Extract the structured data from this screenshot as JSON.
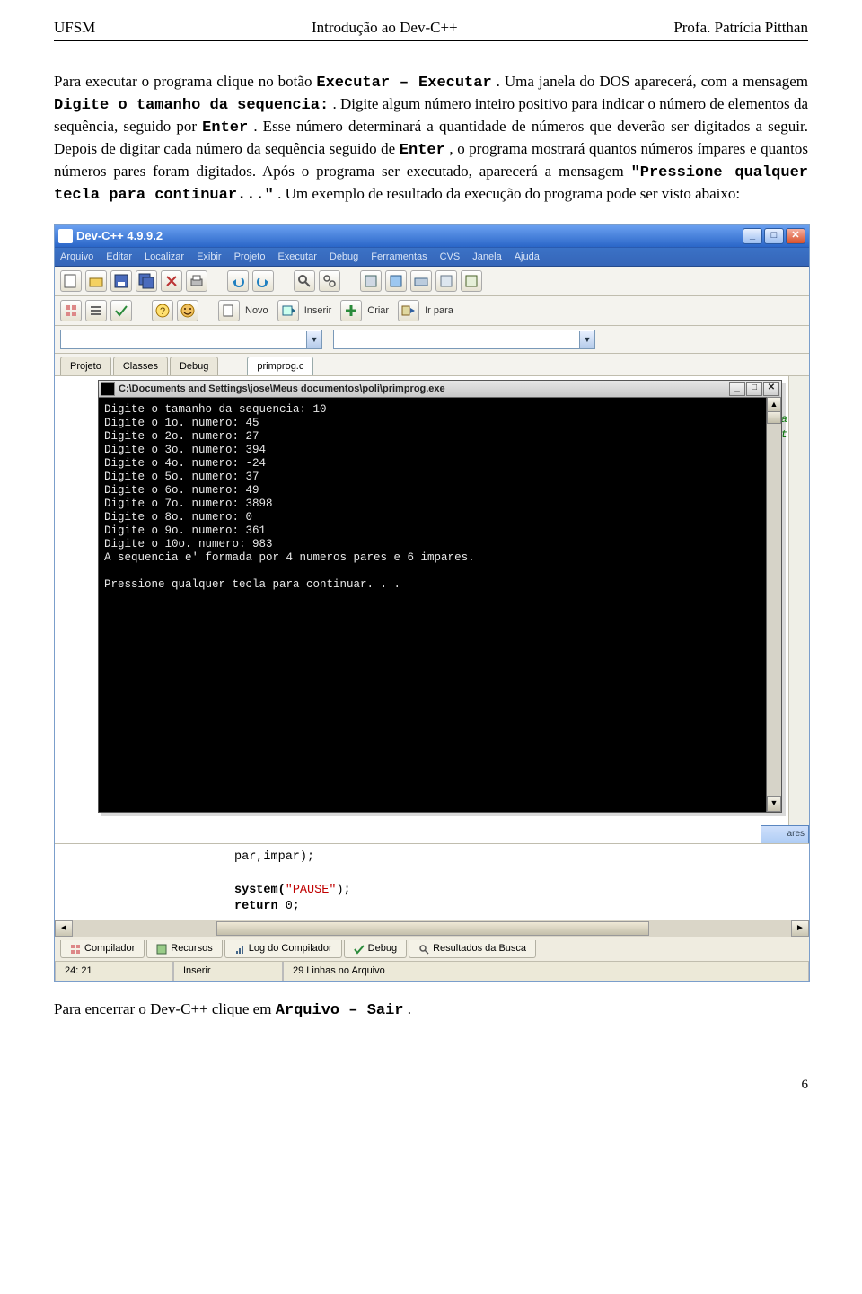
{
  "header": {
    "left": "UFSM",
    "center": "Introdução ao Dev-C++",
    "right": "Profa. Patrícia Pitthan"
  },
  "paragraph": {
    "p1a": "Para executar o programa clique no botão ",
    "p1b": "Executar – Executar",
    "p1c": ". Uma janela do DOS aparecerá, com a mensagem ",
    "p1d": "Digite o tamanho da sequencia:",
    "p1e": ". Digite algum número inteiro positivo para indicar o número de elementos da sequência, seguido por ",
    "p1f": "Enter",
    "p1g": ". Esse número determinará a quantidade de números que deverão ser digitados a seguir. Depois de digitar cada número da sequência seguido de ",
    "p1h": "Enter",
    "p1i": ", o programa mostrará quantos números ímpares e quantos números pares foram digitados. Após o programa ser executado, aparecerá a mensagem ",
    "p1j": "\"Pressione qualquer tecla para continuar...\"",
    "p1k": ". Um exemplo de resultado da execução do programa pode ser visto abaixo:"
  },
  "ide": {
    "title": "Dev-C++ 4.9.9.2",
    "menus": [
      "Arquivo",
      "Editar",
      "Localizar",
      "Exibir",
      "Projeto",
      "Executar",
      "Debug",
      "Ferramentas",
      "CVS",
      "Janela",
      "Ajuda"
    ],
    "toolbar_labels": {
      "novo": "Novo",
      "inserir": "Inserir",
      "criar": "Criar",
      "irpara": "Ir para"
    },
    "side_tabs": [
      "Projeto",
      "Classes",
      "Debug"
    ],
    "file_tab": "primprog.c",
    "peek": "m na\ndo t",
    "right_hint": "ares"
  },
  "console": {
    "title": "C:\\Documents and Settings\\jose\\Meus documentos\\poli\\primprog.exe",
    "lines": [
      "Digite o tamanho da sequencia: 10",
      "Digite o 1o. numero: 45",
      "Digite o 2o. numero: 27",
      "Digite o 3o. numero: 394",
      "Digite o 4o. numero: -24",
      "Digite o 5o. numero: 37",
      "Digite o 6o. numero: 49",
      "Digite o 7o. numero: 3898",
      "Digite o 8o. numero: 0",
      "Digite o 9o. numero: 361",
      "Digite o 10o. numero: 983",
      "A sequencia e' formada por 4 numeros pares e 6 impares.",
      "",
      "Pressione qualquer tecla para continuar. . ."
    ]
  },
  "code_footer": {
    "l1a": "par,impar);",
    "l2a": "system(",
    "l2b": "\"PAUSE\"",
    "l2c": ");",
    "l3a": "return",
    "l3b": " 0;"
  },
  "bottom_tabs": [
    "Compilador",
    "Recursos",
    "Log do Compilador",
    "Debug",
    "Resultados da Busca"
  ],
  "status": {
    "pos": "24: 21",
    "mode": "Inserir",
    "info": "29 Linhas no Arquivo"
  },
  "closing": {
    "a": "Para encerrar o Dev-C++ clique em ",
    "b": "Arquivo – Sair",
    "c": "."
  },
  "page": "6"
}
